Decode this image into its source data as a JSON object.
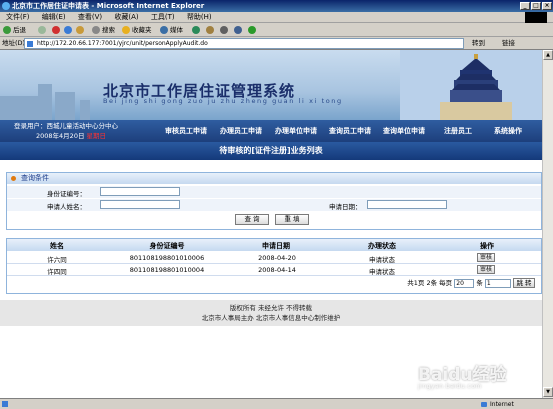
{
  "window": {
    "title": "北京市工作居住证申请表 - Microsoft Internet Explorer"
  },
  "menu": [
    "文件(F)",
    "编辑(E)",
    "查看(V)",
    "收藏(A)",
    "工具(T)",
    "帮助(H)"
  ],
  "toolbar": {
    "back": "后退",
    "search": "搜索",
    "favorites": "收藏夹",
    "media": "媒体"
  },
  "address": {
    "label": "地址(D)",
    "url": "http://172.20.66.177:7001/yjrc/unit/personApplyAudit.do",
    "go": "转到",
    "links": "链接"
  },
  "banner": {
    "title": "北京市工作居住证管理系统",
    "subtitle": "Bei jing shi gong zuo ju zhu zheng guan li xi tong"
  },
  "user": {
    "line1": "登录用户：西城儿童活动中心分中心",
    "date": "2008年4月20日",
    "weekday": "星期日"
  },
  "nav": [
    "审核员工申请",
    "办理员工申请",
    "办理单位申请",
    "查询员工申请",
    "查询单位申请",
    "注册员工",
    "系统操作"
  ],
  "list_title": "待审核的[证件注册]业务列表",
  "query": {
    "panel_title": "查询条件",
    "id_label": "身份证编号：",
    "name_label": "申请人姓名：",
    "date_label": "申请日期：",
    "search_button": "查 询",
    "reset_button": "重 填"
  },
  "table": {
    "columns": [
      "姓名",
      "身份证编号",
      "申请日期",
      "办理状态",
      "操作"
    ],
    "rows": [
      {
        "name": "许六同",
        "id": "801108198801010006",
        "date": "2008-04-20",
        "status": "申请状态",
        "action": "审核"
      },
      {
        "name": "许四同",
        "id": "801108198801010004",
        "date": "2008-04-14",
        "status": "申请状态",
        "action": "审核"
      }
    ]
  },
  "pager": {
    "text1": "共1页 2条 每页",
    "page_size": "20",
    "text2": "条",
    "page": "1",
    "go": "跳 转"
  },
  "footer": {
    "line1": "版权所有 未经允许 不得转载",
    "line2": "北京市人事局主办 北京市人事信息中心制作维护"
  },
  "status": {
    "zone": "Internet"
  },
  "watermark": {
    "brand": "Baidu经验",
    "url": "jingyan.baidu.com"
  }
}
